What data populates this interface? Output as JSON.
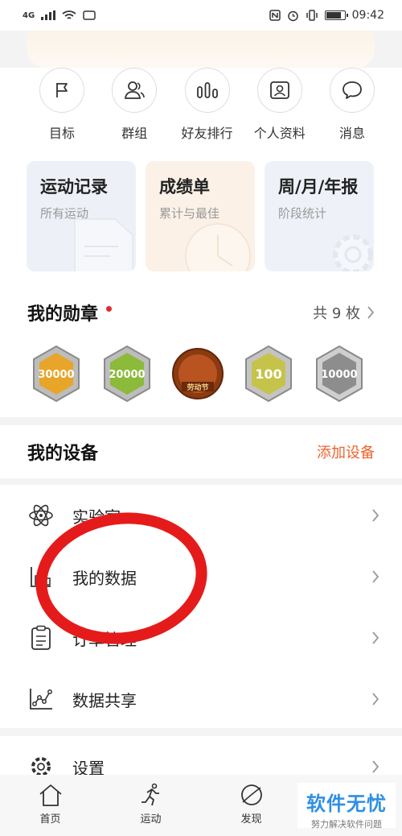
{
  "status_bar": {
    "network": "4G",
    "time": "09:42"
  },
  "quick_actions": [
    {
      "label": "目标",
      "icon": "flag-icon"
    },
    {
      "label": "群组",
      "icon": "group-icon"
    },
    {
      "label": "好友排行",
      "icon": "ranking-icon"
    },
    {
      "label": "个人资料",
      "icon": "profile-icon"
    },
    {
      "label": "消息",
      "icon": "message-icon"
    }
  ],
  "cards": [
    {
      "title": "运动记录",
      "subtitle": "所有运动",
      "bg": "#eef0f7"
    },
    {
      "title": "成绩单",
      "subtitle": "累计与最佳",
      "bg": "#fbf1e7"
    },
    {
      "title": "周/月/年报",
      "subtitle": "阶段统计",
      "bg": "#eef2f8"
    }
  ],
  "medals": {
    "title": "我的勋章",
    "count_label": "共 9 枚",
    "items": [
      {
        "text": "30000",
        "color": "#e7a52a"
      },
      {
        "text": "20000",
        "color": "#8cba3a"
      },
      {
        "text": "劳动节",
        "color": "#b9531f"
      },
      {
        "text": "100",
        "color": "#c6c34a"
      },
      {
        "text": "10000",
        "color": "#8d8d8d"
      }
    ]
  },
  "devices": {
    "title": "我的设备",
    "add_label": "添加设备"
  },
  "menu": [
    {
      "label": "实验室",
      "icon": "atom-icon"
    },
    {
      "label": "我的数据",
      "icon": "data-chart-icon"
    },
    {
      "label": "订单管理",
      "icon": "clipboard-icon"
    },
    {
      "label": "数据共享",
      "icon": "share-graph-icon"
    }
  ],
  "settings": {
    "label": "设置"
  },
  "tabs": [
    {
      "label": "首页",
      "icon": "home-icon"
    },
    {
      "label": "运动",
      "icon": "run-icon"
    },
    {
      "label": "发现",
      "icon": "discover-icon"
    }
  ],
  "watermark": {
    "main": "软件无忧",
    "sub": "努力解决软件问题"
  },
  "colors": {
    "accent": "#f0622c",
    "annotation": "#e51b1b",
    "link": "#2f8fe4"
  }
}
